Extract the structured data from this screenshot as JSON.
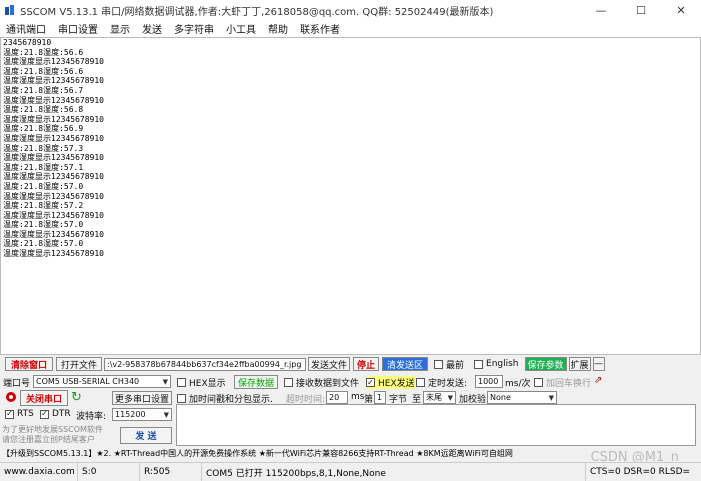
{
  "titlebar": {
    "title": "SSCOM V5.13.1 串口/网络数据调试器,作者:大虾丁丁,2618058@qq.com. QQ群: 52502449(最新版本)",
    "minimize": "—",
    "maximize": "☐",
    "close": "✕"
  },
  "menu": [
    "通讯端口",
    "串口设置",
    "显示",
    "发送",
    "多字符串",
    "小工具",
    "帮助",
    "联系作者"
  ],
  "output_lines": [
    "2345678910",
    "温度:21.8湿度:56.6",
    "温度湿度显示12345678910",
    "温度:21.8湿度:56.6",
    "温度湿度显示12345678910",
    "温度:21.8湿度:56.7",
    "温度湿度显示12345678910",
    "温度:21.8湿度:56.8",
    "温度湿度显示12345678910",
    "温度:21.8湿度:56.9",
    "温度湿度显示12345678910",
    "温度:21.8湿度:57.3",
    "温度湿度显示12345678910",
    "温度:21.8湿度:57.1",
    "温度湿度显示12345678910",
    "温度:21.8湿度:57.0",
    "温度湿度显示12345678910",
    "温度:21.8湿度:57.2",
    "温度湿度显示12345678910",
    "温度:21.8湿度:57.0",
    "温度湿度显示12345678910",
    "温度:21.8湿度:57.0",
    "温度湿度显示12345678910"
  ],
  "toolbar": {
    "clear_window": "清除窗口",
    "open_file": "打开文件",
    "file_path": ":\\v2-958378b67844bb637cf34e2ffba00994_r.jpg",
    "send_file": "发送文件",
    "stop": "停止",
    "clear_send": "清发送区",
    "topmost": "最前",
    "english": "English",
    "save_params": "保存参数",
    "expand": "扩展",
    "collapse": "—"
  },
  "port": {
    "label": "端口号",
    "value": "COM5 USB-SERIAL CH340",
    "hex_display": "HEX显示",
    "save_data": "保存数据",
    "recv_to_file": "接收数据到文件",
    "hex_send": "HEX发送",
    "timed_send": "定时发送:",
    "interval": "1000",
    "interval_unit": "ms/次",
    "add_crlf": "加回车换行"
  },
  "port_row2": {
    "close_port": "关闭串口",
    "more_settings": "更多串口设置",
    "add_timestamp": "加时间戳和分包显示.",
    "timeout_label": "超时时间:",
    "timeout_value": "20",
    "timeout_unit": "ms",
    "byte_label_1": "第",
    "byte_value": "1",
    "byte_label_2": "字节",
    "to_label": "至",
    "to_value": "末尾",
    "checksum_label": "加校验",
    "checksum_value": "None"
  },
  "port_row3": {
    "rts": "RTS",
    "dtr": "DTR",
    "baud_label": "波特率:",
    "baud_value": "115200"
  },
  "promo_left": "为了更好地发展SSCOM软件\n请您注册嘉立创P结尾客户",
  "send_button": "发 送",
  "promo_bar": "【升级到SSCOM5.13.1】★2. ★RT-Thread中国人的开源免费操作系统 ★新一代WiFi芯片兼容8266支持RT-Thread ★8KM远距离WiFi可自组网",
  "status": {
    "website": "www.daxia.com",
    "s": "S:0",
    "r": "R:505",
    "port_info": "COM5 已打开  115200bps,8,1,None,None",
    "signals": "CTS=0 DSR=0 RLSD="
  },
  "watermark": "CSDN @M1_n"
}
